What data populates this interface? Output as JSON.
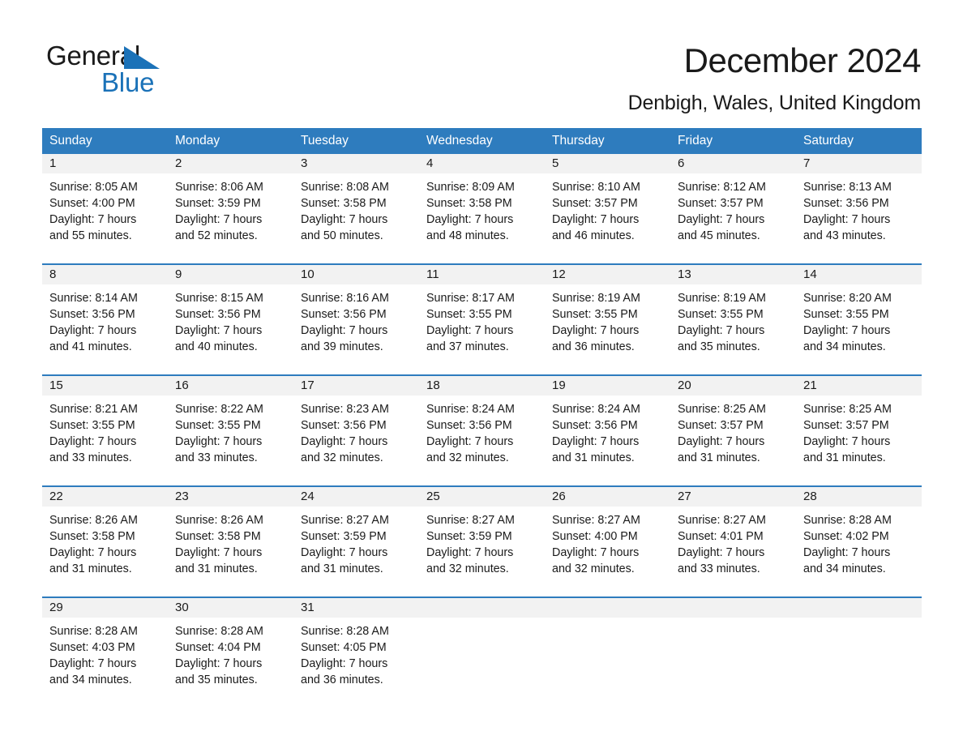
{
  "brand": {
    "name_part1": "General",
    "name_part2": "Blue",
    "accent_color": "#1b72b8"
  },
  "header": {
    "title": "December 2024",
    "subtitle": "Denbigh, Wales, United Kingdom"
  },
  "colors": {
    "header_blue": "#2e7cbe",
    "date_band_gray": "#f2f2f2",
    "text": "#1a1a1a"
  },
  "weekdays": [
    "Sunday",
    "Monday",
    "Tuesday",
    "Wednesday",
    "Thursday",
    "Friday",
    "Saturday"
  ],
  "weeks": [
    {
      "days": [
        {
          "date": "1",
          "sunrise": "Sunrise: 8:05 AM",
          "sunset": "Sunset: 4:00 PM",
          "daylight_1": "Daylight: 7 hours",
          "daylight_2": "and 55 minutes."
        },
        {
          "date": "2",
          "sunrise": "Sunrise: 8:06 AM",
          "sunset": "Sunset: 3:59 PM",
          "daylight_1": "Daylight: 7 hours",
          "daylight_2": "and 52 minutes."
        },
        {
          "date": "3",
          "sunrise": "Sunrise: 8:08 AM",
          "sunset": "Sunset: 3:58 PM",
          "daylight_1": "Daylight: 7 hours",
          "daylight_2": "and 50 minutes."
        },
        {
          "date": "4",
          "sunrise": "Sunrise: 8:09 AM",
          "sunset": "Sunset: 3:58 PM",
          "daylight_1": "Daylight: 7 hours",
          "daylight_2": "and 48 minutes."
        },
        {
          "date": "5",
          "sunrise": "Sunrise: 8:10 AM",
          "sunset": "Sunset: 3:57 PM",
          "daylight_1": "Daylight: 7 hours",
          "daylight_2": "and 46 minutes."
        },
        {
          "date": "6",
          "sunrise": "Sunrise: 8:12 AM",
          "sunset": "Sunset: 3:57 PM",
          "daylight_1": "Daylight: 7 hours",
          "daylight_2": "and 45 minutes."
        },
        {
          "date": "7",
          "sunrise": "Sunrise: 8:13 AM",
          "sunset": "Sunset: 3:56 PM",
          "daylight_1": "Daylight: 7 hours",
          "daylight_2": "and 43 minutes."
        }
      ]
    },
    {
      "days": [
        {
          "date": "8",
          "sunrise": "Sunrise: 8:14 AM",
          "sunset": "Sunset: 3:56 PM",
          "daylight_1": "Daylight: 7 hours",
          "daylight_2": "and 41 minutes."
        },
        {
          "date": "9",
          "sunrise": "Sunrise: 8:15 AM",
          "sunset": "Sunset: 3:56 PM",
          "daylight_1": "Daylight: 7 hours",
          "daylight_2": "and 40 minutes."
        },
        {
          "date": "10",
          "sunrise": "Sunrise: 8:16 AM",
          "sunset": "Sunset: 3:56 PM",
          "daylight_1": "Daylight: 7 hours",
          "daylight_2": "and 39 minutes."
        },
        {
          "date": "11",
          "sunrise": "Sunrise: 8:17 AM",
          "sunset": "Sunset: 3:55 PM",
          "daylight_1": "Daylight: 7 hours",
          "daylight_2": "and 37 minutes."
        },
        {
          "date": "12",
          "sunrise": "Sunrise: 8:19 AM",
          "sunset": "Sunset: 3:55 PM",
          "daylight_1": "Daylight: 7 hours",
          "daylight_2": "and 36 minutes."
        },
        {
          "date": "13",
          "sunrise": "Sunrise: 8:19 AM",
          "sunset": "Sunset: 3:55 PM",
          "daylight_1": "Daylight: 7 hours",
          "daylight_2": "and 35 minutes."
        },
        {
          "date": "14",
          "sunrise": "Sunrise: 8:20 AM",
          "sunset": "Sunset: 3:55 PM",
          "daylight_1": "Daylight: 7 hours",
          "daylight_2": "and 34 minutes."
        }
      ]
    },
    {
      "days": [
        {
          "date": "15",
          "sunrise": "Sunrise: 8:21 AM",
          "sunset": "Sunset: 3:55 PM",
          "daylight_1": "Daylight: 7 hours",
          "daylight_2": "and 33 minutes."
        },
        {
          "date": "16",
          "sunrise": "Sunrise: 8:22 AM",
          "sunset": "Sunset: 3:55 PM",
          "daylight_1": "Daylight: 7 hours",
          "daylight_2": "and 33 minutes."
        },
        {
          "date": "17",
          "sunrise": "Sunrise: 8:23 AM",
          "sunset": "Sunset: 3:56 PM",
          "daylight_1": "Daylight: 7 hours",
          "daylight_2": "and 32 minutes."
        },
        {
          "date": "18",
          "sunrise": "Sunrise: 8:24 AM",
          "sunset": "Sunset: 3:56 PM",
          "daylight_1": "Daylight: 7 hours",
          "daylight_2": "and 32 minutes."
        },
        {
          "date": "19",
          "sunrise": "Sunrise: 8:24 AM",
          "sunset": "Sunset: 3:56 PM",
          "daylight_1": "Daylight: 7 hours",
          "daylight_2": "and 31 minutes."
        },
        {
          "date": "20",
          "sunrise": "Sunrise: 8:25 AM",
          "sunset": "Sunset: 3:57 PM",
          "daylight_1": "Daylight: 7 hours",
          "daylight_2": "and 31 minutes."
        },
        {
          "date": "21",
          "sunrise": "Sunrise: 8:25 AM",
          "sunset": "Sunset: 3:57 PM",
          "daylight_1": "Daylight: 7 hours",
          "daylight_2": "and 31 minutes."
        }
      ]
    },
    {
      "days": [
        {
          "date": "22",
          "sunrise": "Sunrise: 8:26 AM",
          "sunset": "Sunset: 3:58 PM",
          "daylight_1": "Daylight: 7 hours",
          "daylight_2": "and 31 minutes."
        },
        {
          "date": "23",
          "sunrise": "Sunrise: 8:26 AM",
          "sunset": "Sunset: 3:58 PM",
          "daylight_1": "Daylight: 7 hours",
          "daylight_2": "and 31 minutes."
        },
        {
          "date": "24",
          "sunrise": "Sunrise: 8:27 AM",
          "sunset": "Sunset: 3:59 PM",
          "daylight_1": "Daylight: 7 hours",
          "daylight_2": "and 31 minutes."
        },
        {
          "date": "25",
          "sunrise": "Sunrise: 8:27 AM",
          "sunset": "Sunset: 3:59 PM",
          "daylight_1": "Daylight: 7 hours",
          "daylight_2": "and 32 minutes."
        },
        {
          "date": "26",
          "sunrise": "Sunrise: 8:27 AM",
          "sunset": "Sunset: 4:00 PM",
          "daylight_1": "Daylight: 7 hours",
          "daylight_2": "and 32 minutes."
        },
        {
          "date": "27",
          "sunrise": "Sunrise: 8:27 AM",
          "sunset": "Sunset: 4:01 PM",
          "daylight_1": "Daylight: 7 hours",
          "daylight_2": "and 33 minutes."
        },
        {
          "date": "28",
          "sunrise": "Sunrise: 8:28 AM",
          "sunset": "Sunset: 4:02 PM",
          "daylight_1": "Daylight: 7 hours",
          "daylight_2": "and 34 minutes."
        }
      ]
    },
    {
      "days": [
        {
          "date": "29",
          "sunrise": "Sunrise: 8:28 AM",
          "sunset": "Sunset: 4:03 PM",
          "daylight_1": "Daylight: 7 hours",
          "daylight_2": "and 34 minutes."
        },
        {
          "date": "30",
          "sunrise": "Sunrise: 8:28 AM",
          "sunset": "Sunset: 4:04 PM",
          "daylight_1": "Daylight: 7 hours",
          "daylight_2": "and 35 minutes."
        },
        {
          "date": "31",
          "sunrise": "Sunrise: 8:28 AM",
          "sunset": "Sunset: 4:05 PM",
          "daylight_1": "Daylight: 7 hours",
          "daylight_2": "and 36 minutes."
        },
        {
          "date": "",
          "sunrise": "",
          "sunset": "",
          "daylight_1": "",
          "daylight_2": ""
        },
        {
          "date": "",
          "sunrise": "",
          "sunset": "",
          "daylight_1": "",
          "daylight_2": ""
        },
        {
          "date": "",
          "sunrise": "",
          "sunset": "",
          "daylight_1": "",
          "daylight_2": ""
        },
        {
          "date": "",
          "sunrise": "",
          "sunset": "",
          "daylight_1": "",
          "daylight_2": ""
        }
      ]
    }
  ]
}
